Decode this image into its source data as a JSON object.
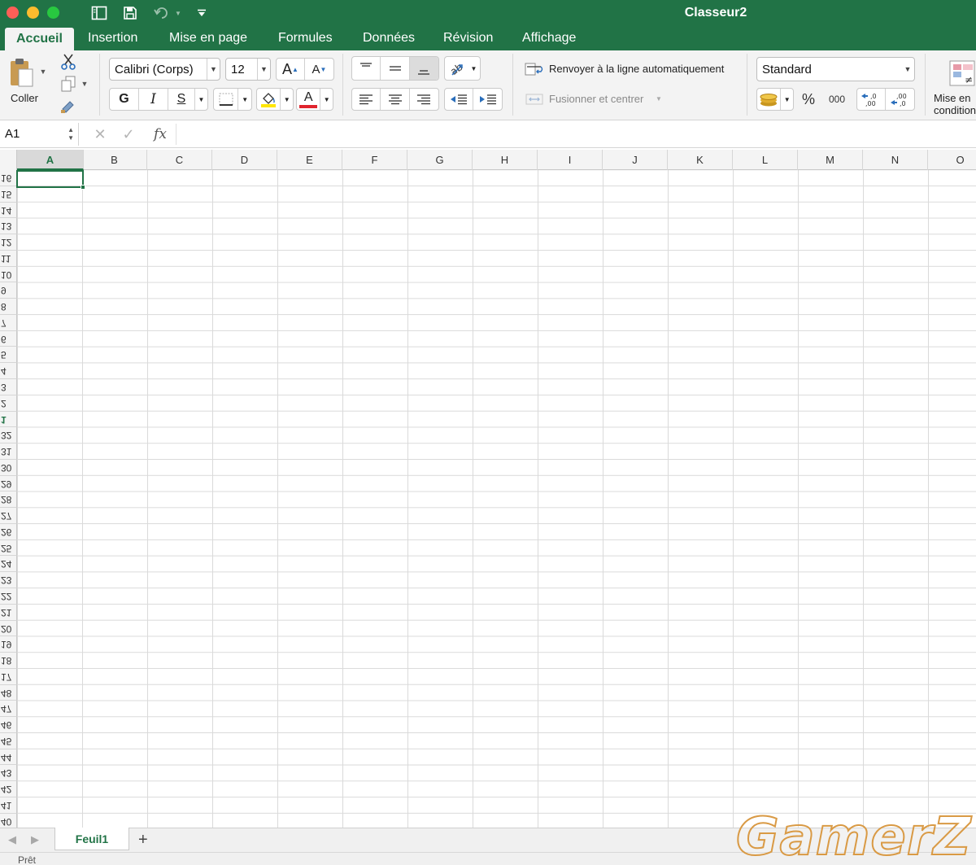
{
  "window": {
    "title": "Classeur2"
  },
  "tabs": [
    {
      "label": "Accueil",
      "active": true
    },
    {
      "label": "Insertion"
    },
    {
      "label": "Mise en page"
    },
    {
      "label": "Formules"
    },
    {
      "label": "Données"
    },
    {
      "label": "Révision"
    },
    {
      "label": "Affichage"
    }
  ],
  "ribbon": {
    "paste_label": "Coller",
    "font_name": "Calibri (Corps)",
    "font_size": "12",
    "bold": "G",
    "italic": "I",
    "underline": "S",
    "font_color_letter": "A",
    "wrap_text_label": "Renvoyer à la ligne automatiquement",
    "merge_label": "Fusionner et centrer",
    "number_format": "Standard",
    "thousands": "000",
    "conditional_line1": "Mise en",
    "conditional_line2": "condition"
  },
  "formula_bar": {
    "name_box": "A1",
    "fx": "fx",
    "content": ""
  },
  "columns": [
    "A",
    "B",
    "C",
    "D",
    "E",
    "F",
    "G",
    "H",
    "I",
    "J",
    "K",
    "L",
    "M",
    "N",
    "O"
  ],
  "row_headers": [
    "16",
    "15",
    "14",
    "13",
    "12",
    "11",
    "10",
    "9",
    "8",
    "7",
    "6",
    "5",
    "4",
    "3",
    "2",
    "1",
    "32",
    "31",
    "30",
    "29",
    "28",
    "27",
    "26",
    "25",
    "24",
    "23",
    "22",
    "21",
    "20",
    "19",
    "18",
    "17",
    "48",
    "47",
    "46",
    "45",
    "44",
    "43",
    "42",
    "41",
    "40"
  ],
  "selected_cell": "A1",
  "sheets": [
    {
      "label": "Feuil1",
      "active": true
    }
  ],
  "status": {
    "text": "Prêt"
  },
  "watermark": "GamerZ",
  "colors": {
    "accent": "#217346",
    "font_color": "#e0242e",
    "highlight": "#ffe600"
  }
}
